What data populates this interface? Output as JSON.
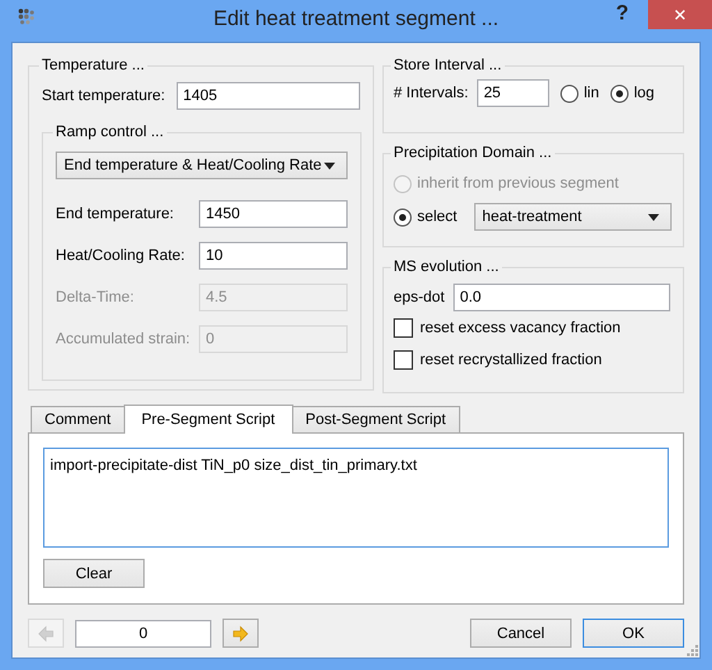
{
  "window": {
    "title": "Edit heat treatment segment ...",
    "help": "?",
    "close": "✕"
  },
  "temperature": {
    "title": "Temperature ...",
    "start_label": "Start temperature:",
    "start_value": "1405",
    "ramp": {
      "title": "Ramp control ...",
      "mode": "End temperature & Heat/Cooling Rate",
      "fields": [
        {
          "label": "End temperature:",
          "value": "1450",
          "disabled": false
        },
        {
          "label": "Heat/Cooling Rate:",
          "value": "10",
          "disabled": false
        },
        {
          "label": "Delta-Time:",
          "value": "4.5",
          "disabled": true
        },
        {
          "label": "Accumulated strain:",
          "value": "0",
          "disabled": true
        }
      ]
    }
  },
  "store_interval": {
    "title": "Store Interval ...",
    "label": "# Intervals:",
    "value": "25",
    "options": [
      {
        "label": "lin",
        "selected": false
      },
      {
        "label": "log",
        "selected": true
      }
    ]
  },
  "precipitation_domain": {
    "title": "Precipitation Domain ...",
    "options": [
      {
        "label": "inherit from previous segment",
        "selected": false,
        "disabled": true
      },
      {
        "label": "select",
        "selected": true,
        "disabled": false
      }
    ],
    "domain": "heat-treatment"
  },
  "ms_evolution": {
    "title": "MS evolution ...",
    "label": "eps-dot",
    "value": "0.0",
    "checks": [
      {
        "label": "reset excess vacancy fraction",
        "checked": false
      },
      {
        "label": "reset recrystallized fraction",
        "checked": false
      }
    ]
  },
  "tabs": [
    {
      "label": "Comment",
      "selected": false
    },
    {
      "label": "Pre-Segment Script",
      "selected": true
    },
    {
      "label": "Post-Segment Script",
      "selected": false
    }
  ],
  "script": "import-precipitate-dist TiN_p0 size_dist_tin_primary.txt",
  "clear_button": "Clear",
  "footer": {
    "prev_disabled": true,
    "next_disabled": false,
    "index": "0",
    "buttons": [
      {
        "label": "Cancel",
        "default": false
      },
      {
        "label": "OK",
        "default": true
      }
    ]
  }
}
